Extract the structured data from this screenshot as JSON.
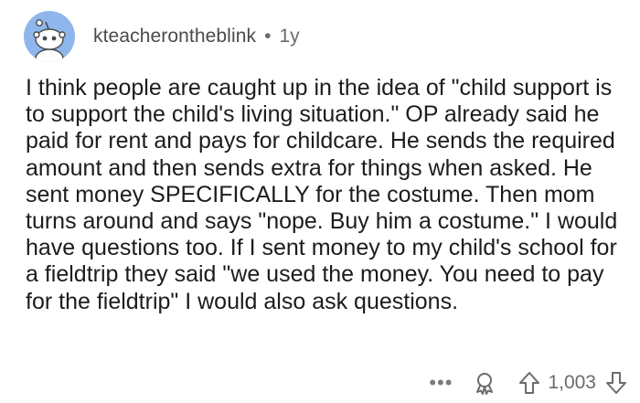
{
  "comment": {
    "username": "kteacherontheblink",
    "separator": "•",
    "age": "1y",
    "body": "I think people are caught up in the idea of \"child support is to support the child's living situation.\" OP already said he paid for rent and pays for childcare. He sends the required amount and then sends extra for things when asked. He sent money SPECIFICALLY for the costume. Then mom turns around and says \"nope. Buy him a costume.\" I would have questions too. If I sent money to my child's school for a fieldtrip they said \"we used the money. You need to pay for the fieldtrip\" I would also ask questions.",
    "actions": {
      "more_label": "•••",
      "score": "1,003"
    }
  },
  "icons": {
    "avatar": "reddit-snoo-avatar",
    "more": "more-options-icon",
    "award": "award-icon",
    "upvote": "upvote-arrow-icon",
    "downvote": "downvote-arrow-icon"
  },
  "colors": {
    "avatar_bg": "#8fb6ec",
    "text": "#1c1c1c",
    "muted": "#6b6b6b"
  }
}
